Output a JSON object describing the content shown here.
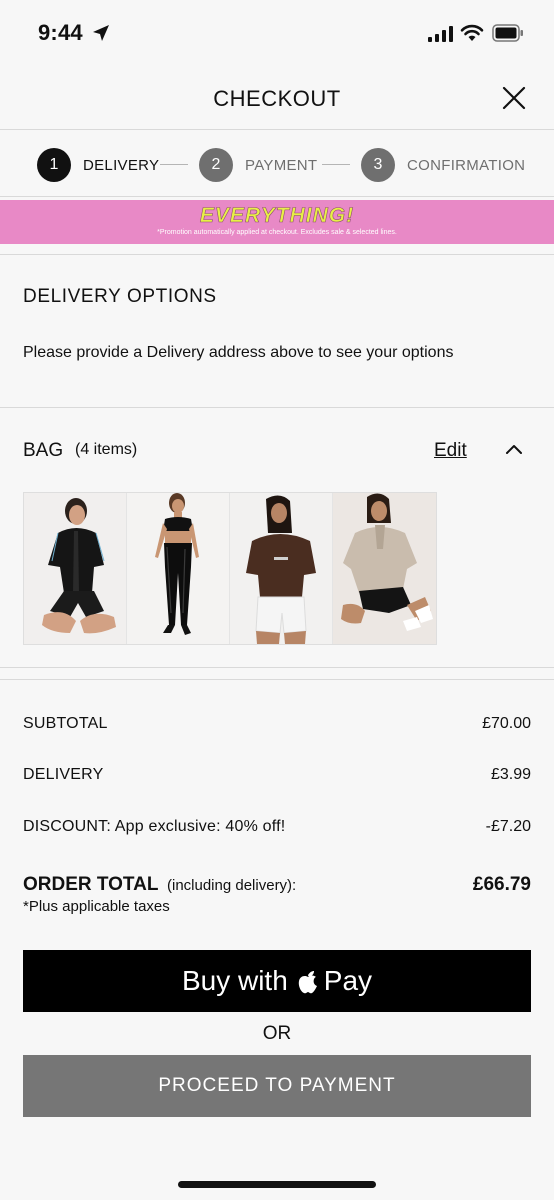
{
  "status_bar": {
    "time": "9:44"
  },
  "header": {
    "title": "CHECKOUT"
  },
  "steps": [
    {
      "num": "1",
      "label": "DELIVERY",
      "active": true
    },
    {
      "num": "2",
      "label": "PAYMENT",
      "active": false
    },
    {
      "num": "3",
      "label": "CONFIRMATION",
      "active": false
    }
  ],
  "promo": {
    "title": "EVERYTHING!",
    "subtitle": "*Promotion automatically applied at checkout. Excludes sale & selected lines.",
    "background_color": "#e889c6"
  },
  "delivery": {
    "title": "DELIVERY OPTIONS",
    "message": "Please provide a Delivery address above to see your options"
  },
  "bag": {
    "title": "BAG",
    "count": "(4 items)",
    "edit_label": "Edit",
    "items": [
      "black-pyjama-set-photo",
      "black-leather-leggings-photo",
      "brown-tshirt-white-shorts-photo",
      "beige-sweatshirt-cycling-shorts-photo"
    ]
  },
  "totals": {
    "subtotal_label": "SUBTOTAL",
    "subtotal_value": "£70.00",
    "delivery_label": "DELIVERY",
    "delivery_value": "£3.99",
    "discount_label": "DISCOUNT: App exclusive: 40% off!",
    "discount_value": "-£7.20",
    "order_total_label": "ORDER TOTAL",
    "order_total_note": "(including delivery):",
    "order_total_value": "£66.79",
    "taxes_note": "*Plus applicable taxes"
  },
  "actions": {
    "applepay_prefix": "Buy with",
    "applepay_suffix": "Pay",
    "or_text": "OR",
    "proceed_label": "PROCEED TO PAYMENT"
  }
}
